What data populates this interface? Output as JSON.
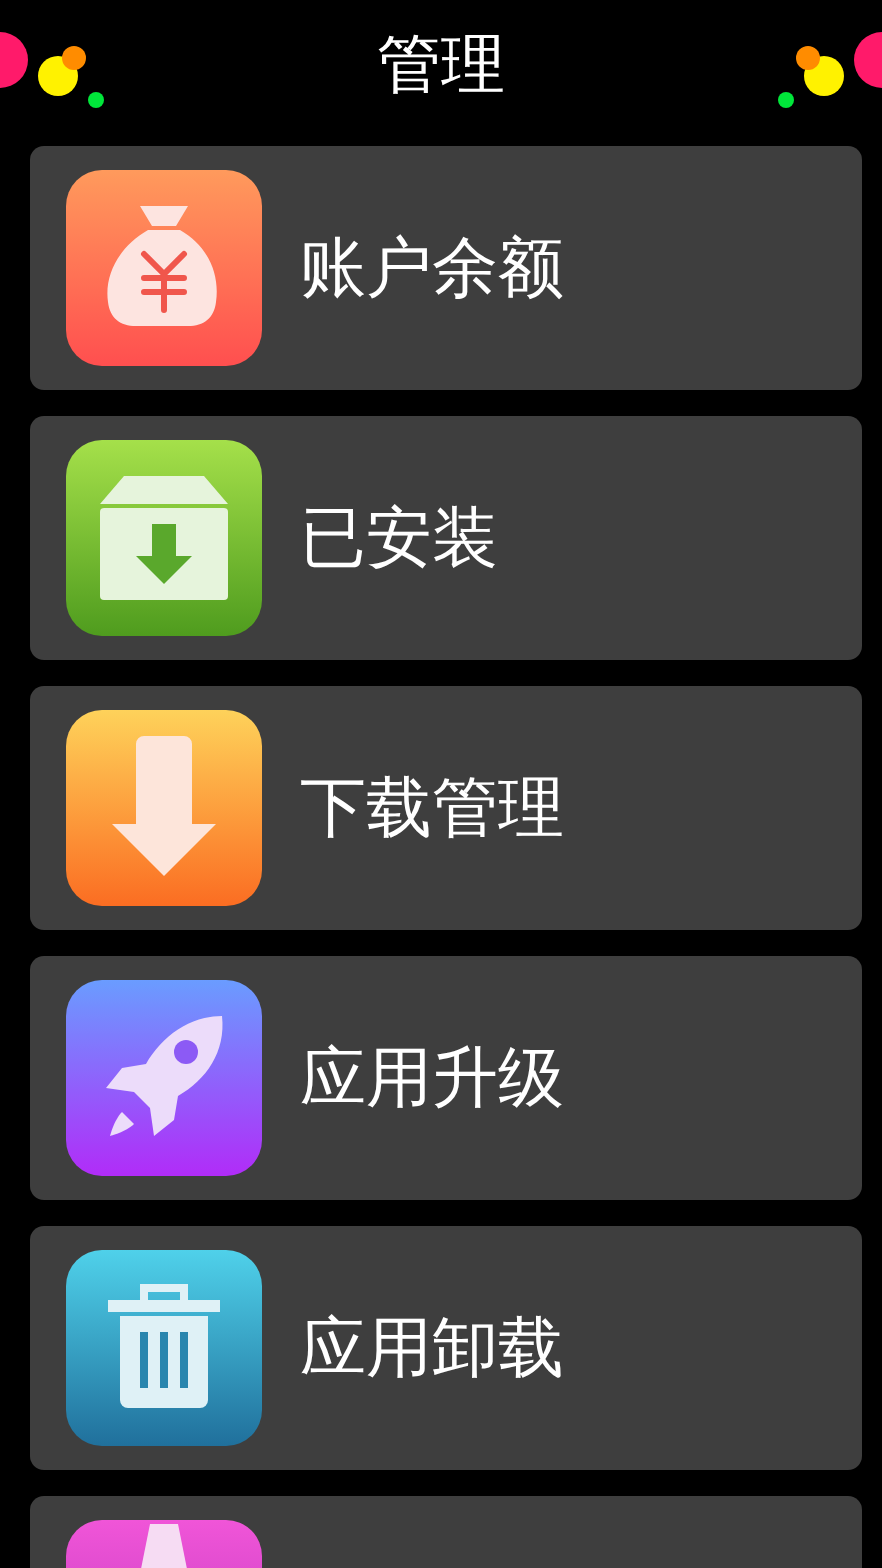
{
  "header": {
    "title": "管理"
  },
  "items": [
    {
      "kind": "wallet",
      "label": "账户余额"
    },
    {
      "kind": "installed",
      "label": "已安装"
    },
    {
      "kind": "download",
      "label": "下载管理"
    },
    {
      "kind": "upgrade",
      "label": "应用升级"
    },
    {
      "kind": "uninstall",
      "label": "应用卸载"
    },
    {
      "kind": "more"
    }
  ]
}
